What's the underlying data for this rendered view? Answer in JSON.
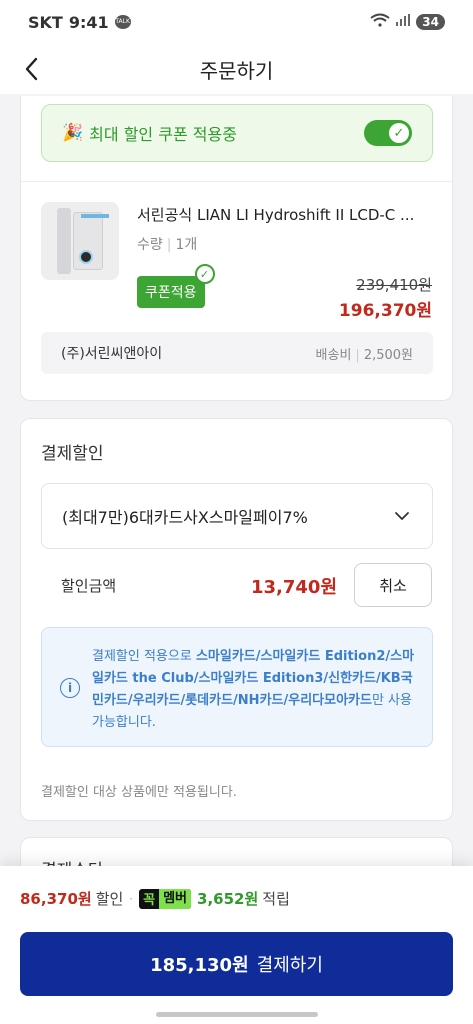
{
  "status": {
    "carrier": "SKT",
    "time": "9:41",
    "talk_icon": "TALK",
    "battery": "34"
  },
  "header": {
    "title": "주문하기"
  },
  "coupon_banner": {
    "emoji": "🎉",
    "text": "최대 할인 쿠폰 적용중",
    "toggle_on": true
  },
  "product": {
    "name": "서린공식 LIAN LI Hydroshift II LCD-C ...",
    "qty_label": "수량",
    "qty_value": "1개",
    "coupon_tag": "쿠폰적용",
    "original_price": "239,410원",
    "final_price": "196,370원"
  },
  "seller": {
    "name": "(주)서린씨앤아이",
    "shipping_label": "배송비",
    "shipping_fee": "2,500원"
  },
  "payment_discount": {
    "title": "결제할인",
    "selected_option": "(최대7만)6대카드사X스마일페이7%",
    "amount_label": "할인금액",
    "amount": "13,740원",
    "cancel_label": "취소",
    "info_prefix": "결제할인 적용으로 ",
    "info_cards": "스마일카드/스마일카드 Edition2/스마일카드 the Club/스마일카드 Edition3/신한카드/KB국민카드/우리카드/롯데카드/NH카드/우리다모아카드",
    "info_suffix": "만 사용 가능합니다.",
    "notice": "결제할인 대상 상품에만 적용됩니다."
  },
  "payment_method": {
    "title": "결제수단"
  },
  "bottom": {
    "discount_total": "86,370원",
    "discount_label": "할인",
    "separator": "·",
    "member_badge_k": "꼭",
    "member_badge_m": "멤버",
    "points": "3,652원",
    "points_label": "적립",
    "pay_amount": "185,130원",
    "pay_label": "결제하기"
  },
  "colors": {
    "accent_green": "#3ca533",
    "discount_red": "#c2291d",
    "pay_blue": "#0f2c99",
    "info_blue": "#3b7ecb"
  }
}
